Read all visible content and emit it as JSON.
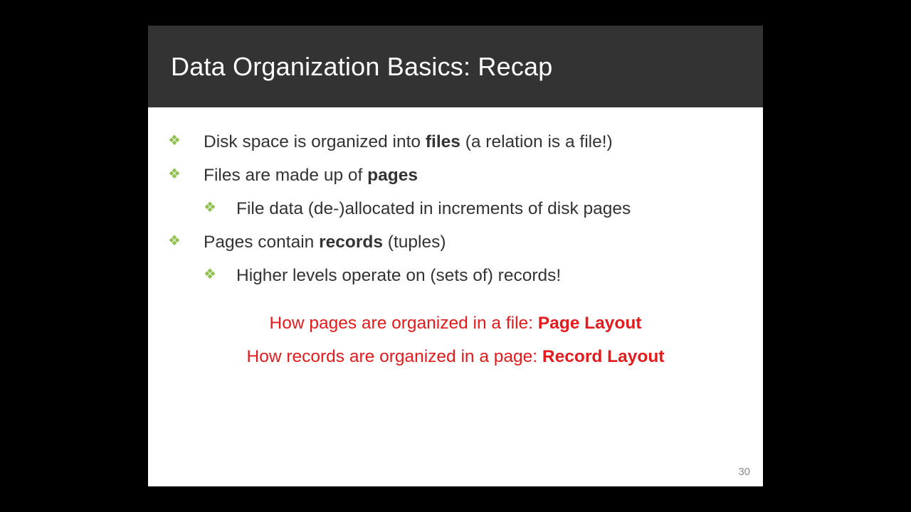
{
  "title": "Data Organization Basics: Recap",
  "bullets": {
    "b1_pre": "Disk space is organized into ",
    "b1_bold": "files",
    "b1_post": " (a relation is a file!)",
    "b2_pre": "Files are made up of ",
    "b2_bold": "pages",
    "b2_sub": "File data (de-)allocated in increments of disk pages",
    "b3_pre": "Pages contain ",
    "b3_bold": "records",
    "b3_post": " (tuples)",
    "b3_sub": "Higher levels operate on (sets of) records!"
  },
  "callout1_pre": "How pages are organized in a file: ",
  "callout1_bold": "Page Layout",
  "callout2_pre": "How records are organized in a page: ",
  "callout2_bold": "Record Layout",
  "page_number": "30"
}
